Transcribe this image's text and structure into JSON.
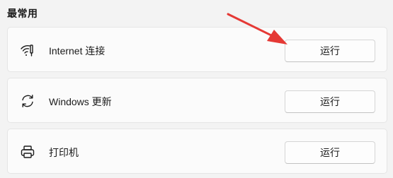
{
  "section": {
    "title": "最常用"
  },
  "troubleshooters": [
    {
      "label": "Internet 连接",
      "icon": "wifi-icon",
      "button_label": "运行"
    },
    {
      "label": "Windows 更新",
      "icon": "refresh-icon",
      "button_label": "运行"
    },
    {
      "label": "打印机",
      "icon": "printer-icon",
      "button_label": "运行"
    }
  ],
  "colors": {
    "card_background": "#fbfbfb",
    "page_background": "#f3f3f3",
    "annotation_arrow": "#e53935"
  }
}
